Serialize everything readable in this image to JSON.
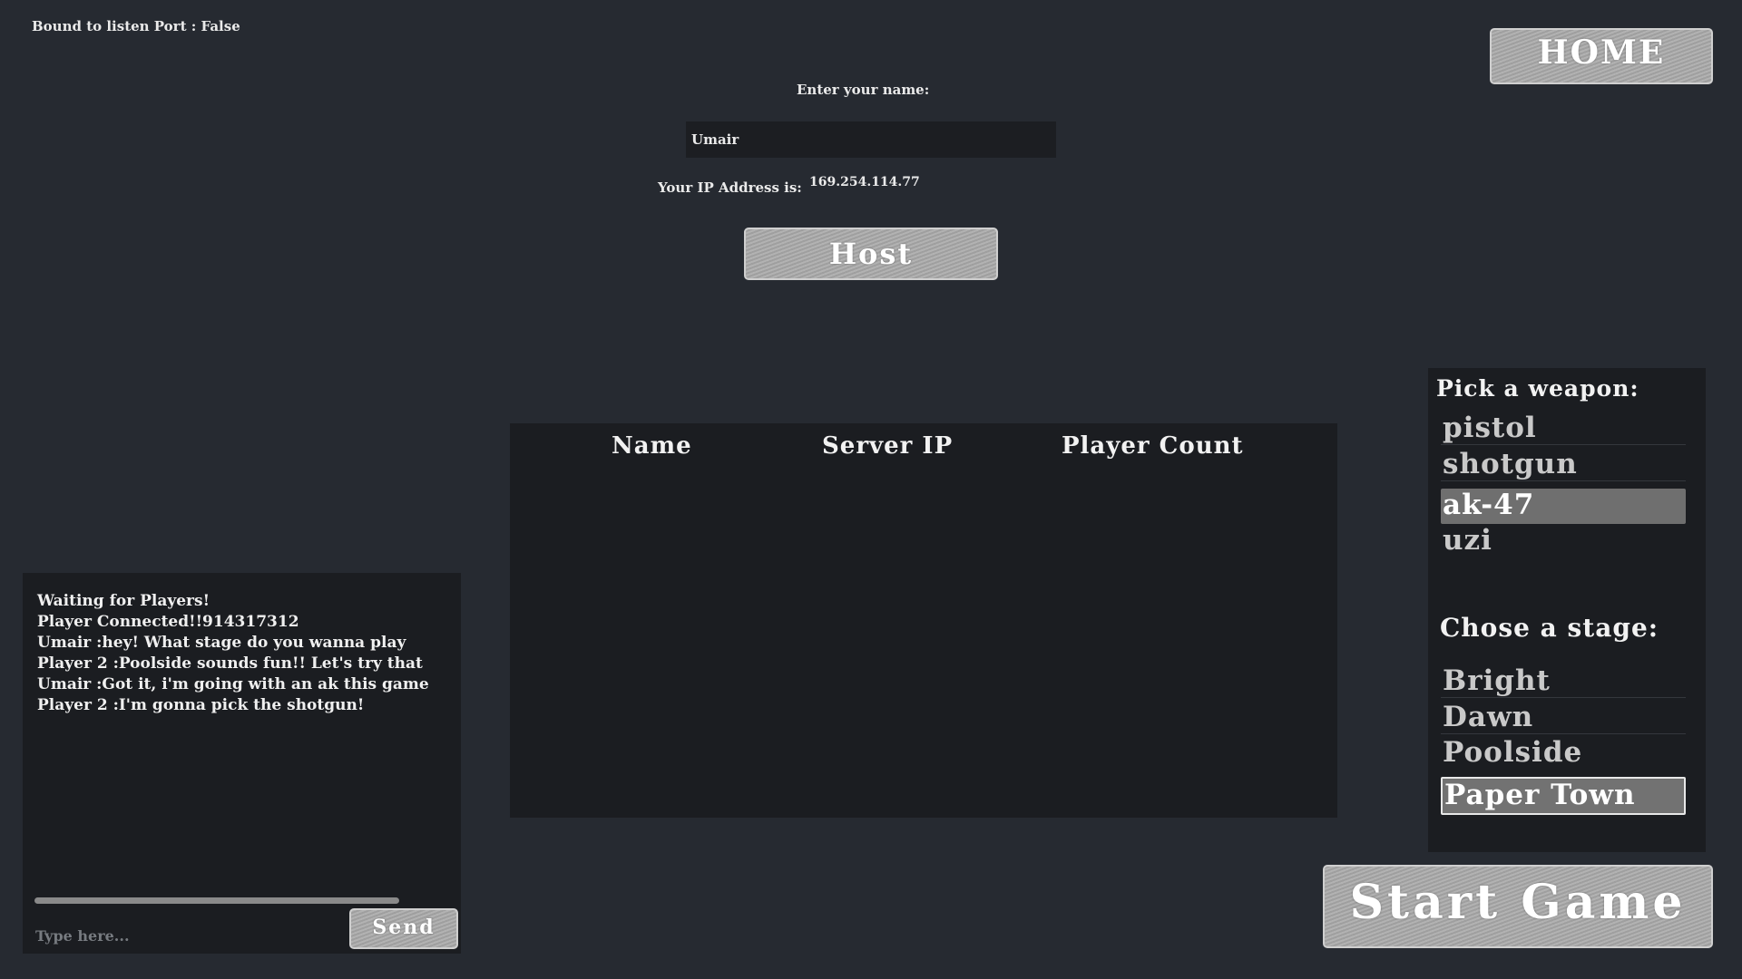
{
  "status": {
    "text": "Bound to listen Port : False"
  },
  "home_button": {
    "label": "HOME"
  },
  "name_prompt": {
    "label": "Enter your name:",
    "value": "Umair"
  },
  "ip": {
    "label": "Your IP Address is:",
    "value": "169.254.114.77"
  },
  "host_button": {
    "label": "Host"
  },
  "server_table": {
    "columns": [
      "Name",
      "Server IP",
      "Player Count"
    ],
    "rows": []
  },
  "chat": {
    "lines": [
      "Waiting for Players!",
      "Player Connected!!914317312",
      "Umair :hey! What stage do you wanna play",
      "Player 2 :Poolside sounds fun!! Let's try that",
      "Umair :Got it, i'm going with an ak this game",
      "Player 2 :I'm gonna pick the shotgun!"
    ],
    "input_placeholder": "Type here...",
    "send_label": "Send"
  },
  "weapons": {
    "heading": "Pick a weapon:",
    "options": [
      "pistol",
      "shotgun",
      "ak-47",
      "uzi"
    ],
    "selected": "ak-47"
  },
  "stages": {
    "heading": "Chose a stage:",
    "options": [
      "Bright",
      "Dawn",
      "Poolside",
      "Paper Town"
    ],
    "selected": "Paper Town"
  },
  "start_button": {
    "label": "Start Game"
  },
  "colors": {
    "background": "#262a31",
    "panel": "#1b1d21",
    "button": "#a9a9a9",
    "selected": "#6f6f6f"
  }
}
